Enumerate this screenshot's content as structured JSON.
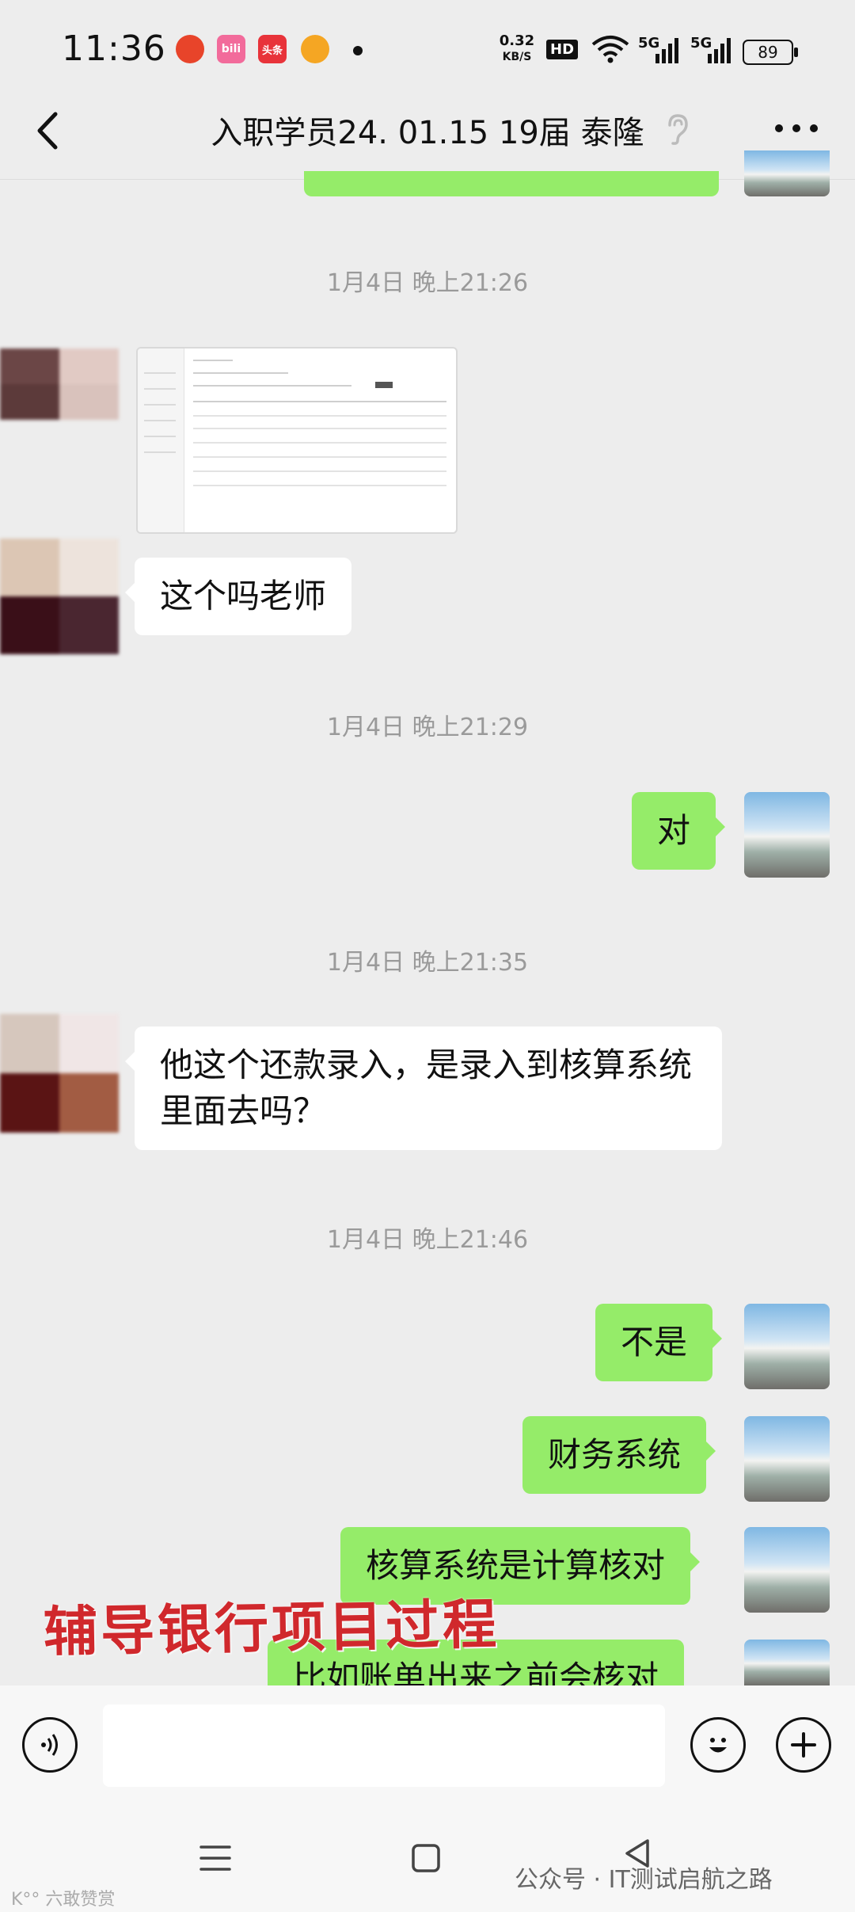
{
  "status_bar": {
    "time": "11:36",
    "net_speed_value": "0.32",
    "net_speed_unit": "KB/S",
    "hd": "HD",
    "signal_1": "5G",
    "signal_2": "5G",
    "battery": "89",
    "app_icons": [
      "weibo-like-app-icon",
      "bilibili-icon",
      "toutiao-icon",
      "weibo-icon"
    ],
    "app_icon_labels": [
      "",
      "bili",
      "头条",
      ""
    ]
  },
  "nav": {
    "back_icon": "chevron-left-icon",
    "title": "入职学员24. 01.15 19届 泰隆",
    "ear_icon": "ear-icon",
    "more_icon": "more-icon"
  },
  "chat": {
    "timestamps": [
      "1月4日 晚上21:26",
      "1月4日 晚上21:29",
      "1月4日 晚上21:35",
      "1月4日 晚上21:46"
    ],
    "messages": [
      {
        "side": "other",
        "text": "这个吗老师"
      },
      {
        "side": "me",
        "text": "对"
      },
      {
        "side": "other",
        "text": "他这个还款录入，是录入到核算系统里面去吗？"
      },
      {
        "side": "me",
        "text": "不是"
      },
      {
        "side": "me",
        "text": "财务系统"
      },
      {
        "side": "me",
        "text": "核算系统是计算核对"
      },
      {
        "side": "me",
        "text": "比如账单出来之前会核对"
      }
    ]
  },
  "overlay_caption": "辅导银行项目过程",
  "input_bar": {
    "voice_icon": "voice-icon",
    "emoji_icon": "emoji-icon",
    "plus_icon": "plus-icon",
    "text_value": ""
  },
  "system_nav": {
    "menu_icon": "menu-icon",
    "home_icon": "home-icon",
    "back_icon": "back-triangle-icon"
  },
  "watermark": "公众号 · IT测试启航之路",
  "watermark_small": "K°° 六敢赞赏",
  "colors": {
    "my_bubble": "#95ec69",
    "other_bubble": "#ffffff",
    "background": "#ededed",
    "caption_red": "#d0282c"
  }
}
